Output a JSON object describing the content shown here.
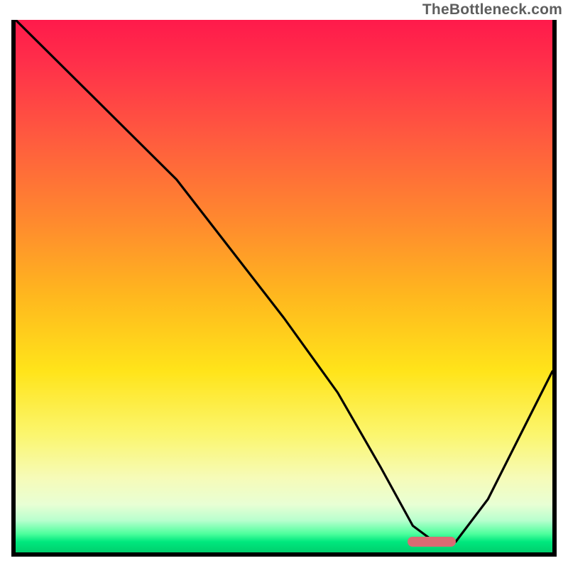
{
  "attribution": "TheBottleneck.com",
  "colors": {
    "frame": "#000000",
    "curve": "#000000",
    "marker": "#db6b73",
    "gradient_top": "#ff1a4b",
    "gradient_bottom": "#00cf6d"
  },
  "chart_data": {
    "type": "line",
    "title": "",
    "xlabel": "",
    "ylabel": "",
    "xlim": [
      0,
      100
    ],
    "ylim": [
      0,
      100
    ],
    "grid": false,
    "legend": false,
    "annotations": [],
    "series": [
      {
        "name": "curve",
        "x": [
          0,
          10,
          22,
          30,
          40,
          50,
          60,
          68,
          74,
          78,
          82,
          88,
          94,
          100
        ],
        "y": [
          100,
          90,
          78,
          70,
          57,
          44,
          30,
          16,
          5,
          2,
          2,
          10,
          22,
          34
        ]
      }
    ],
    "marker": {
      "x_start": 73,
      "x_end": 82,
      "y": 2,
      "label": ""
    },
    "background_gradient_stops": [
      {
        "pos": 0,
        "color": "#ff1a4b"
      },
      {
        "pos": 22,
        "color": "#ff5a3f"
      },
      {
        "pos": 52,
        "color": "#ffb81e"
      },
      {
        "pos": 78,
        "color": "#fbf66f"
      },
      {
        "pos": 94,
        "color": "#b8ffce"
      },
      {
        "pos": 100,
        "color": "#00cf6d"
      }
    ]
  }
}
